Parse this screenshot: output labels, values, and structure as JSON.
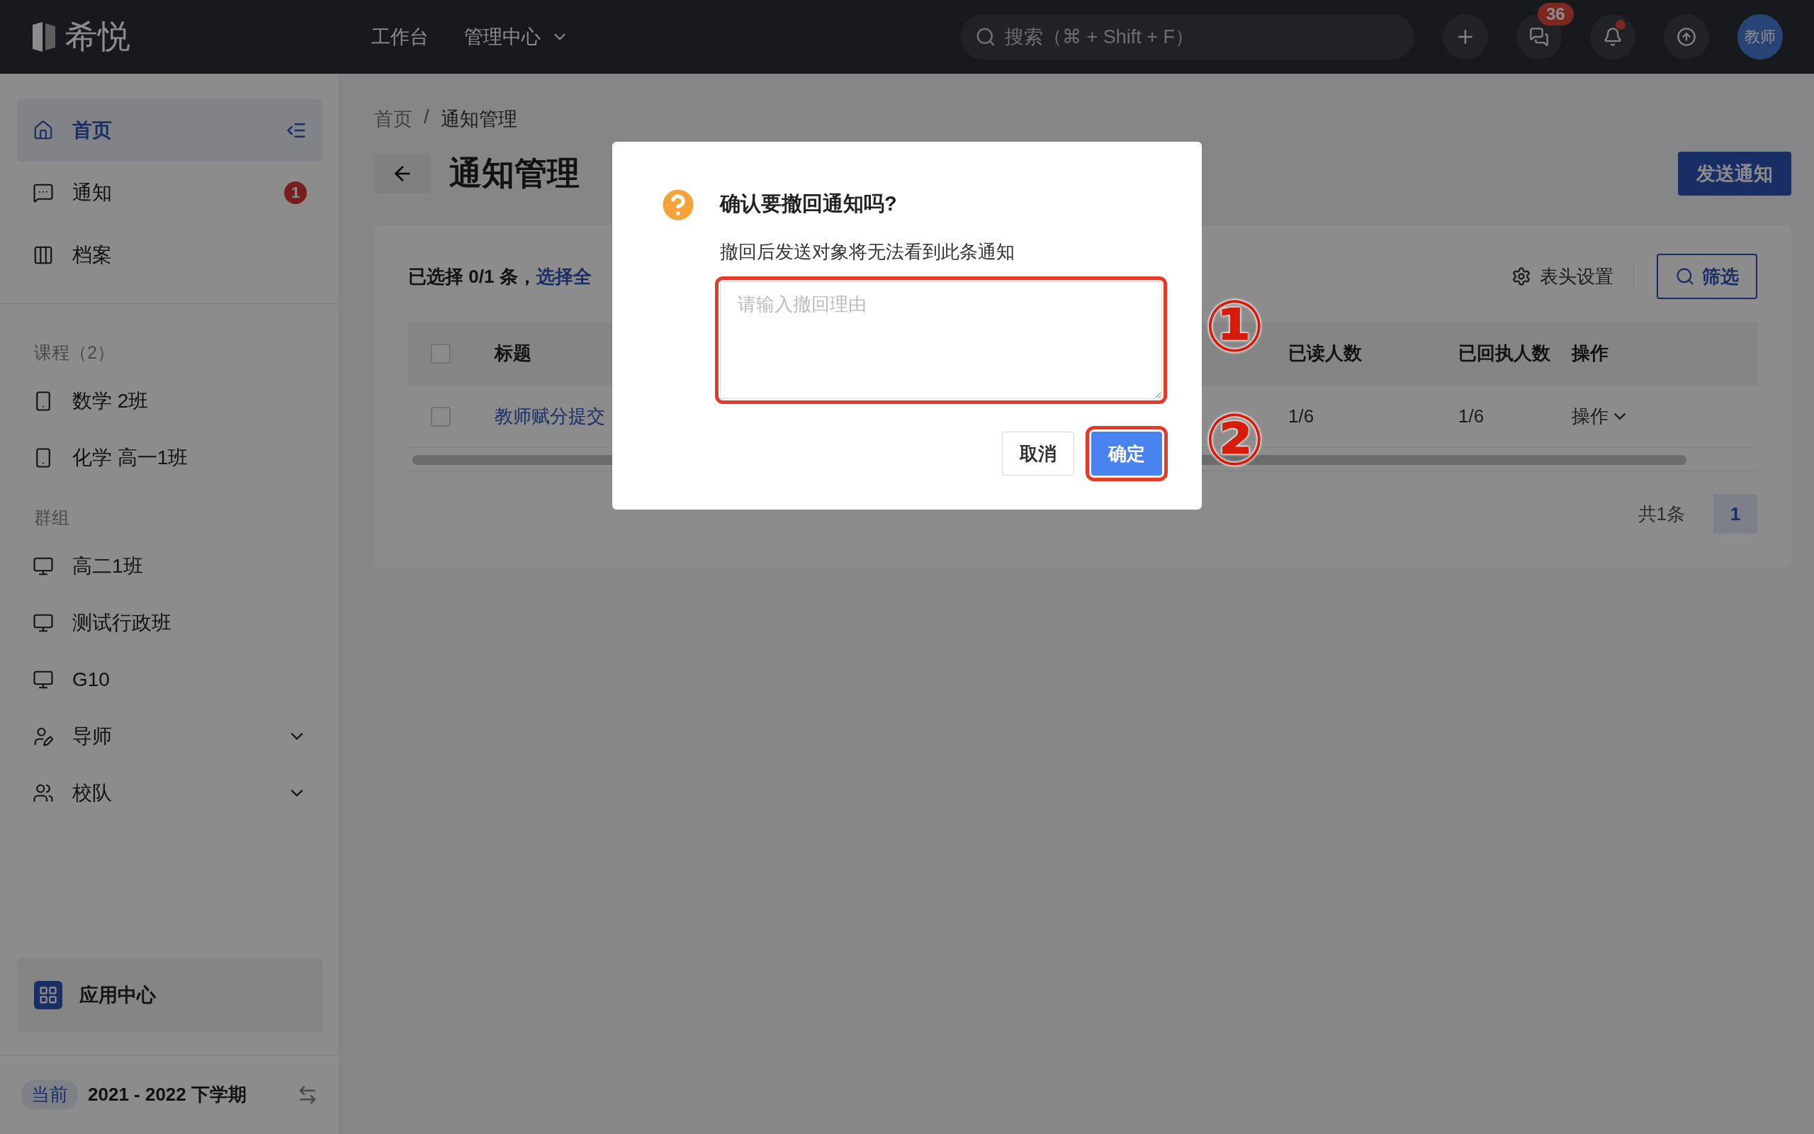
{
  "topbar": {
    "logo": "希悦",
    "nav": [
      {
        "label": "工作台",
        "dropdown": false
      },
      {
        "label": "管理中心",
        "dropdown": true
      }
    ],
    "search": {
      "placeholder": "搜索（⌘ + Shift + F）"
    },
    "messages_badge": "36",
    "notification_dot": true,
    "avatar": "教师"
  },
  "sidebar": {
    "items": [
      {
        "kind": "home",
        "label": "首页",
        "selected": true
      },
      {
        "kind": "notice",
        "label": "通知",
        "selected": false,
        "badge": "1"
      },
      {
        "kind": "archive",
        "label": "档案",
        "selected": false
      }
    ],
    "sections": [
      {
        "title": "课程（2）",
        "items": [
          {
            "kind": "course",
            "label": "数学 2班",
            "expandable": false
          },
          {
            "kind": "course",
            "label": "化学 高一1班",
            "expandable": false
          }
        ]
      },
      {
        "title": "群组",
        "items": [
          {
            "kind": "group",
            "label": "高二1班",
            "expandable": false
          },
          {
            "kind": "group",
            "label": "测试行政班",
            "expandable": false
          },
          {
            "kind": "group",
            "label": "G10",
            "expandable": false
          },
          {
            "kind": "tutor",
            "label": "导师",
            "expandable": true
          },
          {
            "kind": "team",
            "label": "校队",
            "expandable": true
          }
        ]
      }
    ],
    "app_center": "应用中心",
    "term": {
      "tag": "当前",
      "label": "2021 - 2022 下学期"
    }
  },
  "main": {
    "breadcrumb": {
      "separator": "/",
      "items": [
        "首页",
        "通知管理"
      ]
    },
    "title": "通知管理",
    "send_button": "发送通知",
    "toolbar": {
      "selection": "已选择 0/1 条，",
      "select_all": "选择全",
      "column_settings": "表头设置",
      "filter": "筛选"
    },
    "table": {
      "all_checked": false,
      "columns": [
        "标题",
        "已读人数",
        "已回执人数",
        "操作"
      ],
      "rows": [
        {
          "checked": false,
          "title": "教师赋分提交",
          "read": "1/6",
          "receipt": "1/6",
          "action": "操作"
        }
      ]
    },
    "pagination": {
      "total": "共1条",
      "pages": [
        {
          "label": "1",
          "selected": true
        }
      ]
    }
  },
  "dialog": {
    "title": "确认要撤回通知吗?",
    "message": "撤回后发送对象将无法看到此条通知",
    "reason": {
      "placeholder": "请输入撤回理由"
    },
    "cancel": "取消",
    "confirm": "确定"
  },
  "annotations": [
    "①",
    "②"
  ]
}
